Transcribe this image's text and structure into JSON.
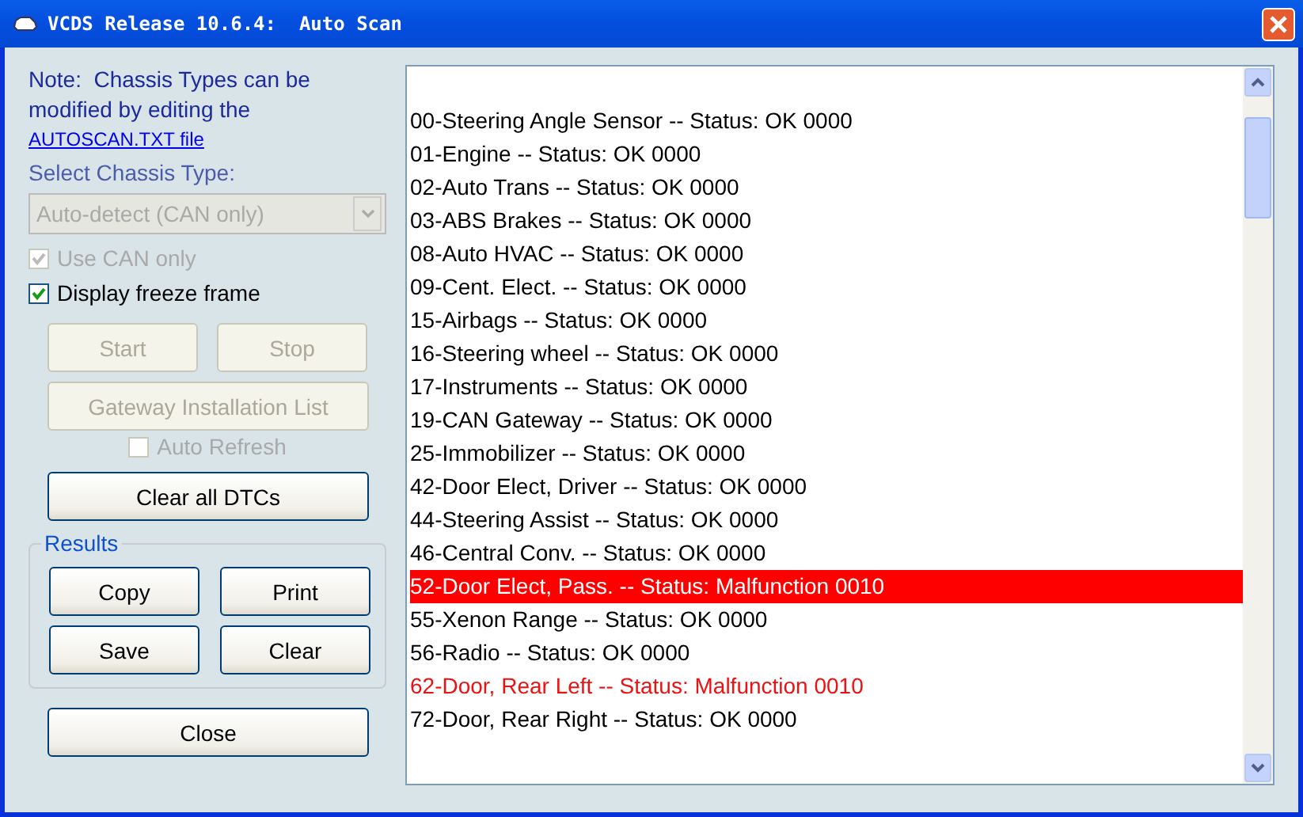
{
  "window": {
    "title": "VCDS Release 10.6.4:  Auto Scan"
  },
  "note": {
    "text": "Note:  Chassis Types can be modified by editing the",
    "link": "AUTOSCAN.TXT file"
  },
  "chassis": {
    "label": "Select Chassis Type:",
    "value": "Auto-detect (CAN only)",
    "disabled": true
  },
  "options": [
    {
      "label": "Use CAN only",
      "checked": true,
      "disabled": true
    },
    {
      "label": "Display freeze frame",
      "checked": true,
      "disabled": false
    }
  ],
  "scan_buttons": [
    {
      "label": "Start",
      "disabled": true
    },
    {
      "label": "Stop",
      "disabled": true
    }
  ],
  "gateway_button": {
    "label": "Gateway Installation List",
    "disabled": true
  },
  "auto_refresh": {
    "label": "Auto Refresh",
    "checked": false,
    "disabled": true
  },
  "clear_dtcs_button": {
    "label": "Clear all DTCs",
    "disabled": false
  },
  "results": {
    "title": "Results",
    "buttons": [
      {
        "label": "Copy"
      },
      {
        "label": "Print"
      },
      {
        "label": "Save"
      },
      {
        "label": "Clear"
      }
    ]
  },
  "close_button": {
    "label": "Close"
  },
  "scan_results": [
    {
      "text": "00-Steering Angle Sensor -- Status: OK 0000",
      "kind": "ok",
      "selected": false
    },
    {
      "text": "01-Engine -- Status: OK 0000",
      "kind": "ok",
      "selected": false
    },
    {
      "text": "02-Auto Trans -- Status: OK 0000",
      "kind": "ok",
      "selected": false
    },
    {
      "text": "03-ABS Brakes -- Status: OK 0000",
      "kind": "ok",
      "selected": false
    },
    {
      "text": "08-Auto HVAC -- Status: OK 0000",
      "kind": "ok",
      "selected": false
    },
    {
      "text": "09-Cent. Elect. -- Status: OK 0000",
      "kind": "ok",
      "selected": false
    },
    {
      "text": "15-Airbags -- Status: OK 0000",
      "kind": "ok",
      "selected": false
    },
    {
      "text": "16-Steering wheel -- Status: OK 0000",
      "kind": "ok",
      "selected": false
    },
    {
      "text": "17-Instruments -- Status: OK 0000",
      "kind": "ok",
      "selected": false
    },
    {
      "text": "19-CAN Gateway -- Status: OK 0000",
      "kind": "ok",
      "selected": false
    },
    {
      "text": "25-Immobilizer -- Status: OK 0000",
      "kind": "ok",
      "selected": false
    },
    {
      "text": "42-Door Elect, Driver -- Status: OK 0000",
      "kind": "ok",
      "selected": false
    },
    {
      "text": "44-Steering Assist -- Status: OK 0000",
      "kind": "ok",
      "selected": false
    },
    {
      "text": "46-Central Conv. -- Status: OK 0000",
      "kind": "ok",
      "selected": false
    },
    {
      "text": "52-Door Elect, Pass. -- Status: Malfunction 0010",
      "kind": "malfunction",
      "selected": true
    },
    {
      "text": "55-Xenon Range -- Status: OK 0000",
      "kind": "ok",
      "selected": false
    },
    {
      "text": "56-Radio -- Status: OK 0000",
      "kind": "ok",
      "selected": false
    },
    {
      "text": "62-Door, Rear Left -- Status: Malfunction 0010",
      "kind": "malfunction",
      "selected": false
    },
    {
      "text": "72-Door, Rear Right -- Status: OK 0000",
      "kind": "ok",
      "selected": false
    }
  ]
}
